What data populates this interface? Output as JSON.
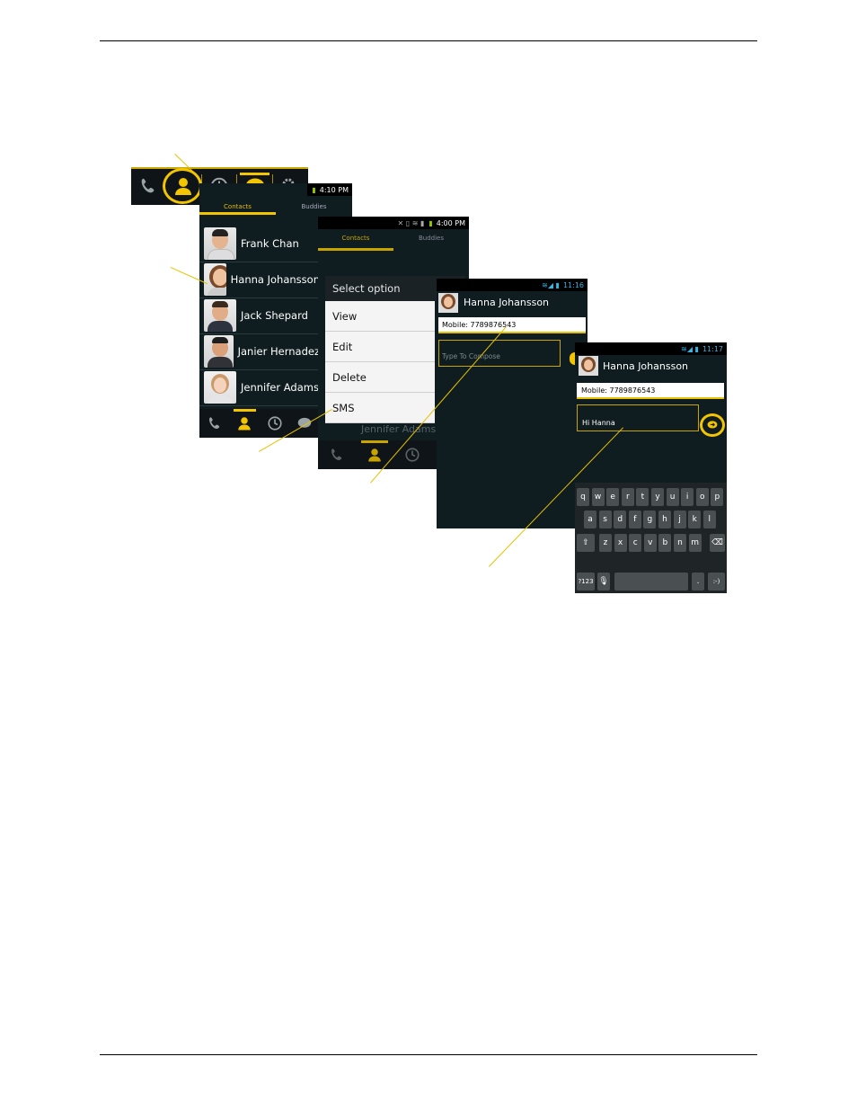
{
  "tabbar_icons": [
    "phone-icon",
    "contacts-icon",
    "history-icon",
    "chat-icon",
    "settings-icon"
  ],
  "screen1": {
    "status_time": "4:10 PM",
    "tabs": [
      "Contacts",
      "Buddies"
    ],
    "contacts": [
      "Frank Chan",
      "Hanna Johansson",
      "Jack Shepard",
      "Janier Hernadez",
      "Jennifer Adams"
    ]
  },
  "screen2": {
    "status_time": "4:00 PM",
    "tabs": [
      "Contacts",
      "Buddies"
    ],
    "menu_title": "Select option",
    "options": [
      "View",
      "Edit",
      "Delete",
      "SMS"
    ],
    "behind_name": "Jennifer Adams"
  },
  "screen3": {
    "status_time": "11:16",
    "contact_name": "Hanna Johansson",
    "mobile": "Mobile: 7789876543",
    "compose_placeholder": "Type To Compose"
  },
  "screen4": {
    "status_time": "11:17",
    "contact_name": "Hanna Johansson",
    "mobile": "Mobile: 7789876543",
    "message_text": "Hi Hanna",
    "keyboard_rows": [
      [
        "q",
        "w",
        "e",
        "r",
        "t",
        "y",
        "u",
        "i",
        "o",
        "p"
      ],
      [
        "a",
        "s",
        "d",
        "f",
        "g",
        "h",
        "j",
        "k",
        "l"
      ],
      [
        "z",
        "x",
        "c",
        "v",
        "b",
        "n",
        "m"
      ]
    ],
    "sym_key": "?123",
    "period_key": ".",
    "smiley_key": ":-)"
  },
  "colors": {
    "accent": "#f2c500",
    "dark_bg": "#0f1c20",
    "bar_bg": "#0e1418"
  }
}
